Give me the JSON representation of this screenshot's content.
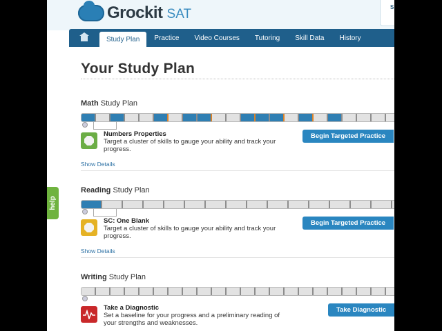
{
  "header": {
    "brand": "Grockit",
    "product": "SAT",
    "top_right_text": "S"
  },
  "nav": {
    "items": [
      {
        "label": "Study Plan",
        "active": true
      },
      {
        "label": "Practice"
      },
      {
        "label": "Video Courses"
      },
      {
        "label": "Tutoring"
      },
      {
        "label": "Skill Data"
      },
      {
        "label": "History"
      }
    ]
  },
  "page": {
    "title": "Your Study Plan"
  },
  "plans": [
    {
      "subject": "Math",
      "suffix": "Study Plan",
      "activity_title": "Numbers Properties",
      "activity_desc": "Target a cluster of skills to gauge your ability and track your progress.",
      "button": "Begin Targeted Practice",
      "link": "Show Details",
      "icon": "hexagon-icon",
      "icon_color": "#6bad45"
    },
    {
      "subject": "Reading",
      "suffix": "Study Plan",
      "activity_title": "SC: One Blank",
      "activity_desc": "Target a cluster of skills to gauge your ability and track your progress.",
      "button": "Begin Targeted Practice",
      "link": "Show Details",
      "icon": "hexagon-icon",
      "icon_color": "#e5b225"
    },
    {
      "subject": "Writing",
      "suffix": "Study Plan",
      "activity_title": "Take a Diagnostic",
      "activity_desc": "Set a baseline for your progress and a preliminary reading of your strengths and weaknesses.",
      "button": "Take Diagnostic",
      "icon": "pulse-icon",
      "icon_color": "#c9282a"
    }
  ],
  "help": {
    "label": "help"
  },
  "colors": {
    "nav": "#1f5f8b",
    "accent": "#2a86c0",
    "done_segment": "#2f7fb3",
    "pending_segment": "#e2e2e2",
    "help": "#6fb33f"
  }
}
